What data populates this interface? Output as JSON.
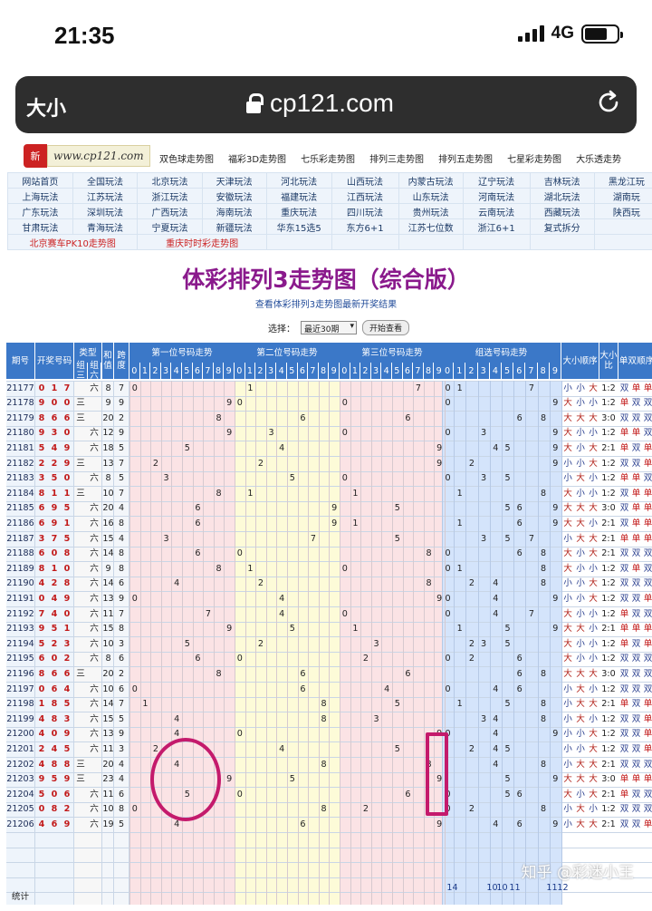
{
  "status": {
    "time": "21:35",
    "network": "4G"
  },
  "browser": {
    "text_size": "大小",
    "domain": "cp121.com"
  },
  "site": {
    "logo_badge": "新",
    "logo_text": "www.cp121.com",
    "top_nav": [
      "双色球走势图",
      "福彩3D走势图",
      "七乐彩走势图",
      "排列三走势图",
      "排列五走势图",
      "七星彩走势图",
      "大乐透走势"
    ],
    "link_rows": [
      [
        "网站首页",
        "全国玩法",
        "北京玩法",
        "天津玩法",
        "河北玩法",
        "山西玩法",
        "内蒙古玩法",
        "辽宁玩法",
        "吉林玩法",
        "黑龙江玩"
      ],
      [
        "上海玩法",
        "江苏玩法",
        "浙江玩法",
        "安徽玩法",
        "福建玩法",
        "江西玩法",
        "山东玩法",
        "河南玩法",
        "湖北玩法",
        "湖南玩"
      ],
      [
        "广东玩法",
        "深圳玩法",
        "广西玩法",
        "海南玩法",
        "重庆玩法",
        "四川玩法",
        "贵州玩法",
        "云南玩法",
        "西藏玩法",
        "陕西玩"
      ],
      [
        "甘肃玩法",
        "青海玩法",
        "宁夏玩法",
        "新疆玩法",
        "华东15选5",
        "东方6+1",
        "江苏七位数",
        "浙江6+1",
        "复式拆分",
        ""
      ]
    ],
    "red_links": [
      "北京赛车PK10走势图",
      "重庆时时彩走势图"
    ],
    "title": "体彩排列3走势图（综合版）",
    "subtitle": "查看体彩排列3走势图最新开奖结果",
    "select_label": "选择：",
    "select_value": "最近30期",
    "button": "开始查看",
    "watermark": "知乎 @彩迷小王"
  },
  "table": {
    "headers": {
      "issue": "期号",
      "draw": "开奖号码",
      "type": "类型",
      "type_a": "组三",
      "type_b": "组六",
      "sum": "和值",
      "span": "跨度",
      "pos1": "第一位号码走势",
      "pos2": "第二位号码走势",
      "pos3": "第三位号码走势",
      "group": "组选号码走势",
      "bigsmall": "大小顺序",
      "bigsmall_ratio": "大小比",
      "oddeven": "单双顺序"
    },
    "digits": [
      "0",
      "1",
      "2",
      "3",
      "4",
      "5",
      "6",
      "7",
      "8",
      "9"
    ],
    "rows": [
      [
        "21177",
        "0",
        "1",
        "7",
        "六",
        "8",
        "7",
        "小",
        "小",
        "大",
        "1:2",
        "双",
        "单",
        "单"
      ],
      [
        "21178",
        "9",
        "0",
        "0",
        "三",
        "9",
        "9",
        "大",
        "小",
        "小",
        "1:2",
        "单",
        "双",
        "双"
      ],
      [
        "21179",
        "8",
        "6",
        "6",
        "三",
        "20",
        "2",
        "大",
        "大",
        "大",
        "3:0",
        "双",
        "双",
        "双"
      ],
      [
        "21180",
        "9",
        "3",
        "0",
        "六",
        "12",
        "9",
        "大",
        "小",
        "小",
        "1:2",
        "单",
        "单",
        "双"
      ],
      [
        "21181",
        "5",
        "4",
        "9",
        "六",
        "18",
        "5",
        "大",
        "小",
        "大",
        "2:1",
        "单",
        "双",
        "单"
      ],
      [
        "21182",
        "2",
        "2",
        "9",
        "三",
        "13",
        "7",
        "小",
        "小",
        "大",
        "1:2",
        "双",
        "双",
        "单"
      ],
      [
        "21183",
        "3",
        "5",
        "0",
        "六",
        "8",
        "5",
        "小",
        "大",
        "小",
        "1:2",
        "单",
        "单",
        "双"
      ],
      [
        "21184",
        "8",
        "1",
        "1",
        "三",
        "10",
        "7",
        "大",
        "小",
        "小",
        "1:2",
        "双",
        "单",
        "单"
      ],
      [
        "21185",
        "6",
        "9",
        "5",
        "六",
        "20",
        "4",
        "大",
        "大",
        "大",
        "3:0",
        "双",
        "单",
        "单"
      ],
      [
        "21186",
        "6",
        "9",
        "1",
        "六",
        "16",
        "8",
        "大",
        "大",
        "小",
        "2:1",
        "双",
        "单",
        "单"
      ],
      [
        "21187",
        "3",
        "7",
        "5",
        "六",
        "15",
        "4",
        "小",
        "大",
        "大",
        "2:1",
        "单",
        "单",
        "单"
      ],
      [
        "21188",
        "6",
        "0",
        "8",
        "六",
        "14",
        "8",
        "大",
        "小",
        "大",
        "2:1",
        "双",
        "双",
        "双"
      ],
      [
        "21189",
        "8",
        "1",
        "0",
        "六",
        "9",
        "8",
        "大",
        "小",
        "小",
        "1:2",
        "双",
        "单",
        "双"
      ],
      [
        "21190",
        "4",
        "2",
        "8",
        "六",
        "14",
        "6",
        "小",
        "小",
        "大",
        "1:2",
        "双",
        "双",
        "双"
      ],
      [
        "21191",
        "0",
        "4",
        "9",
        "六",
        "13",
        "9",
        "小",
        "小",
        "大",
        "1:2",
        "双",
        "双",
        "单"
      ],
      [
        "21192",
        "7",
        "4",
        "0",
        "六",
        "11",
        "7",
        "大",
        "小",
        "小",
        "1:2",
        "单",
        "双",
        "双"
      ],
      [
        "21193",
        "9",
        "5",
        "1",
        "六",
        "15",
        "8",
        "大",
        "大",
        "小",
        "2:1",
        "单",
        "单",
        "单"
      ],
      [
        "21194",
        "5",
        "2",
        "3",
        "六",
        "10",
        "3",
        "大",
        "小",
        "小",
        "1:2",
        "单",
        "双",
        "单"
      ],
      [
        "21195",
        "6",
        "0",
        "2",
        "六",
        "8",
        "6",
        "大",
        "小",
        "小",
        "1:2",
        "双",
        "双",
        "双"
      ],
      [
        "21196",
        "8",
        "6",
        "6",
        "三",
        "20",
        "2",
        "大",
        "大",
        "大",
        "3:0",
        "双",
        "双",
        "双"
      ],
      [
        "21197",
        "0",
        "6",
        "4",
        "六",
        "10",
        "6",
        "小",
        "大",
        "小",
        "1:2",
        "双",
        "双",
        "双"
      ],
      [
        "21198",
        "1",
        "8",
        "5",
        "六",
        "14",
        "7",
        "小",
        "大",
        "大",
        "2:1",
        "单",
        "双",
        "单"
      ],
      [
        "21199",
        "4",
        "8",
        "3",
        "六",
        "15",
        "5",
        "小",
        "大",
        "小",
        "1:2",
        "双",
        "双",
        "单"
      ],
      [
        "21200",
        "4",
        "0",
        "9",
        "六",
        "13",
        "9",
        "小",
        "小",
        "大",
        "1:2",
        "双",
        "双",
        "单"
      ],
      [
        "21201",
        "2",
        "4",
        "5",
        "六",
        "11",
        "3",
        "小",
        "小",
        "大",
        "1:2",
        "双",
        "双",
        "单"
      ],
      [
        "21202",
        "4",
        "8",
        "8",
        "三",
        "20",
        "4",
        "小",
        "大",
        "大",
        "2:1",
        "双",
        "双",
        "双"
      ],
      [
        "21203",
        "9",
        "5",
        "9",
        "三",
        "23",
        "4",
        "大",
        "大",
        "大",
        "3:0",
        "单",
        "单",
        "单"
      ],
      [
        "21204",
        "5",
        "0",
        "6",
        "六",
        "11",
        "6",
        "大",
        "小",
        "大",
        "2:1",
        "单",
        "双",
        "双"
      ],
      [
        "21205",
        "0",
        "8",
        "2",
        "六",
        "10",
        "8",
        "小",
        "大",
        "小",
        "1:2",
        "双",
        "双",
        "双"
      ],
      [
        "21206",
        "4",
        "6",
        "9",
        "六",
        "19",
        "5",
        "小",
        "大",
        "大",
        "2:1",
        "双",
        "双",
        "单"
      ]
    ],
    "bottom_label": "统计",
    "bottom_values": [
      "14",
      "10",
      "10",
      "11",
      "11",
      "12"
    ]
  }
}
